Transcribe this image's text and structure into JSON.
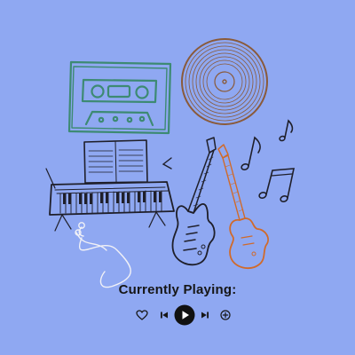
{
  "heading": "Currently Playing:",
  "colors": {
    "background": "#8fa8f2",
    "cassette": "#3d8a73",
    "vinyl": "#8a5a3a",
    "ink": "#1f1f2a",
    "orange_guitar": "#d06a2a"
  },
  "player": {
    "controls": [
      {
        "name": "like",
        "icon": "heart-icon"
      },
      {
        "name": "previous",
        "icon": "skip-previous-icon"
      },
      {
        "name": "play",
        "icon": "play-icon"
      },
      {
        "name": "next",
        "icon": "skip-next-icon"
      },
      {
        "name": "add",
        "icon": "plus-circle-icon"
      }
    ]
  }
}
